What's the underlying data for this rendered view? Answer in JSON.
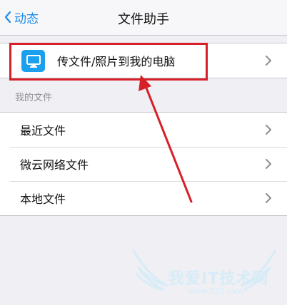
{
  "navbar": {
    "back_label": "动态",
    "title": "文件助手"
  },
  "transfer": {
    "label": "传文件/照片到我的电脑"
  },
  "my_files": {
    "section_label": "我的文件",
    "items": [
      {
        "label": "最近文件"
      },
      {
        "label": "微云网络文件"
      },
      {
        "label": "本地文件"
      }
    ]
  },
  "watermark": {
    "text": "我爱IT技术网",
    "url": "www.52ij.com"
  },
  "colors": {
    "accent": "#1a8cf0",
    "highlight": "#d61f28",
    "icon_bg": "#1aa0ee"
  }
}
